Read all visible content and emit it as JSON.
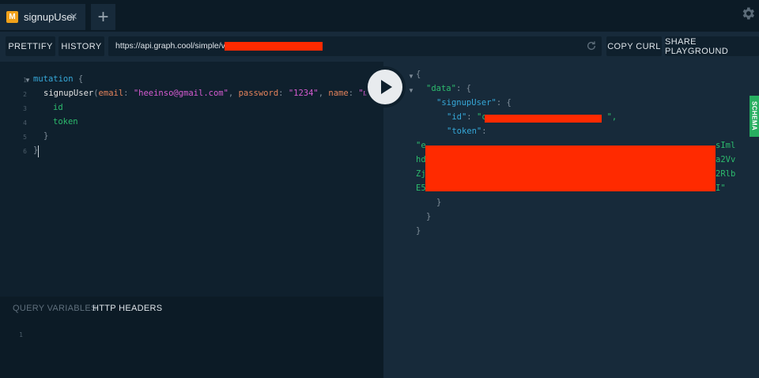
{
  "tab": {
    "logo_letter": "M",
    "title": "signupUser",
    "close_glyph": "×",
    "add_glyph": "+",
    "icons": {
      "settings": "gear-icon",
      "close": "close-icon",
      "add": "plus-icon"
    }
  },
  "toolbar": {
    "prettify_label": "PRETTIFY",
    "history_label": "HISTORY",
    "url_value": "https://api.graph.cool/simple/v1/c",
    "reload_icon": "reload-icon",
    "copy_curl_label": "COPY CURL",
    "share_label": "SHARE PLAYGROUND"
  },
  "editor": {
    "line_numbers": [
      "1",
      "2",
      "3",
      "4",
      "5",
      "6"
    ],
    "lines": {
      "l1_kw": "mutation",
      "l1_brace": " {",
      "l2_fn": "signupUser",
      "l2_open": "(",
      "l2_arg1": "email",
      "l2_colon1": ": ",
      "l2_val1": "\"heeinso@gmail.com\"",
      "l2_comma1": ", ",
      "l2_arg2": "password",
      "l2_colon2": ": ",
      "l2_val2": "\"1234\"",
      "l2_comma2": ", ",
      "l2_arg3": "name",
      "l2_colon3": ": ",
      "l2_val3": "\"m.",
      "l3_field": "id",
      "l4_field": "token",
      "l5_brace": "}",
      "l6_brace": "}"
    }
  },
  "play_button_icon": "play-icon",
  "variables": {
    "tab_query_vars": "QUERY VARIABLES",
    "tab_http_headers": "HTTP HEADERS",
    "line_number": "1"
  },
  "result": {
    "r1": "{",
    "r2_key": "\"data\"",
    "r2_rest": ": {",
    "r3_key": "\"signupUser\"",
    "r3_rest": ": {",
    "r4_key": "\"id\"",
    "r4_colon": ": ",
    "r4_val_start": "\"c",
    "r4_val_end": "\",",
    "r5_key": "\"token\"",
    "r5_colon": ":",
    "tok1_a": "\"e",
    "tok1_b": "sIml",
    "tok2_a": "hd",
    "tok2_b": "a2Vv",
    "tok3_a": "Zj",
    "tok3_b": "2Rlb",
    "tok4_a": "E5",
    "tok4_b": "I\"",
    "r_close1": "}",
    "r_close2": "}",
    "r_close3": "}"
  },
  "schema_label": "SCHEMA",
  "colors": {
    "redaction": "#ff2a00",
    "schema_tab": "#27ae60",
    "tab_logo": "#f0a11a",
    "keyword": "#36a8d8",
    "field": "#2dbb6d",
    "argument": "#e4825b",
    "string": "#d65bd1"
  }
}
